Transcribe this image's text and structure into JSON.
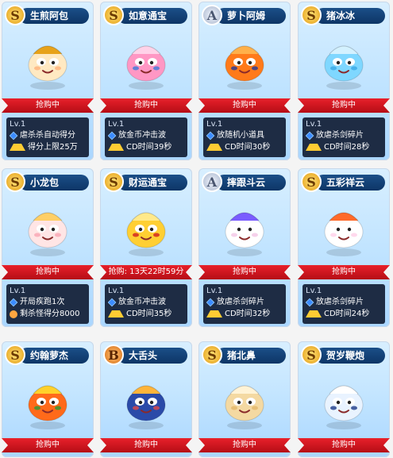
{
  "purchase_label": "抢购中",
  "level": "Lv.1",
  "rows": [
    [
      {
        "name": "生煎阿包",
        "grade": "S",
        "buy": "抢购中",
        "skills": [
          {
            "icon": "diamond",
            "text": "虐杀杀自动得分"
          },
          {
            "icon": "arrow",
            "text": "得分上限25万"
          }
        ],
        "colors": [
          "#ffe9c2",
          "#ffb17a",
          "#e7a21a"
        ]
      },
      {
        "name": "如意通宝",
        "grade": "S",
        "buy": "抢购中",
        "skills": [
          {
            "icon": "diamond",
            "text": "放金币冲击波"
          },
          {
            "icon": "arrow",
            "text": "CD时间39秒"
          }
        ],
        "colors": [
          "#ff97c4",
          "#3c7ad9",
          "#ffd2e8"
        ]
      },
      {
        "name": "萝卜阿姆",
        "grade": "A",
        "buy": "抢购中",
        "skills": [
          {
            "icon": "diamond",
            "text": "放随机小道具"
          },
          {
            "icon": "arrow",
            "text": "CD时间30秒"
          }
        ],
        "colors": [
          "#ff7a1a",
          "#223a9b",
          "#ffb04a"
        ]
      },
      {
        "name": "猪冰冰",
        "grade": "S",
        "buy": "抢购中",
        "skills": [
          {
            "icon": "diamond",
            "text": "放虐杀剑碎片"
          },
          {
            "icon": "arrow",
            "text": "CD时间28秒"
          }
        ],
        "colors": [
          "#7fd7ff",
          "#3aa9e6",
          "#d3f1ff"
        ]
      }
    ],
    [
      {
        "name": "小龙包",
        "grade": "S",
        "buy": "抢购中",
        "skills": [
          {
            "icon": "diamond",
            "text": "开局疾跑1次"
          },
          {
            "icon": "person",
            "text": "剩杀怪得分8000"
          }
        ],
        "colors": [
          "#ffe5e5",
          "#f9a5b3",
          "#ffcf66"
        ]
      },
      {
        "name": "财运通宝",
        "grade": "S",
        "buy": "抢购: 13天22时59分",
        "skills": [
          {
            "icon": "diamond",
            "text": "放金币冲击波"
          },
          {
            "icon": "arrow",
            "text": "CD时间35秒"
          }
        ],
        "colors": [
          "#ffcf33",
          "#d11e1e",
          "#ffe98a"
        ]
      },
      {
        "name": "摔跟斗云",
        "grade": "A",
        "buy": "抢购中",
        "skills": [
          {
            "icon": "diamond",
            "text": "放虐杀剑碎片"
          },
          {
            "icon": "arrow",
            "text": "CD时间32秒"
          }
        ],
        "colors": [
          "#ffffff",
          "#f2c6e6",
          "#7a5cff"
        ]
      },
      {
        "name": "五彩祥云",
        "grade": "S",
        "buy": "抢购中",
        "skills": [
          {
            "icon": "diamond",
            "text": "放虐杀剑碎片"
          },
          {
            "icon": "arrow",
            "text": "CD时间24秒"
          }
        ],
        "colors": [
          "#ffffff",
          "#ffd0e8",
          "#ff6a2a"
        ]
      }
    ],
    [
      {
        "name": "约翰萝杰",
        "grade": "S",
        "buy": "抢购中",
        "colors": [
          "#ff6a1a",
          "#2a9a3a",
          "#ffd12a"
        ]
      },
      {
        "name": "大舌头",
        "grade": "B",
        "buy": "抢购中",
        "colors": [
          "#2a4aa8",
          "#e04848",
          "#ffb43a"
        ]
      },
      {
        "name": "猪北鼻",
        "grade": "S",
        "buy": "抢购中",
        "colors": [
          "#f4d9a2",
          "#e2b66a",
          "#fff3d6"
        ]
      },
      {
        "name": "贺岁鞭炮",
        "grade": "S",
        "buy": "抢购中",
        "colors": [
          "#e9f3ff",
          "#1b3a88",
          "#ffffff"
        ]
      }
    ]
  ]
}
